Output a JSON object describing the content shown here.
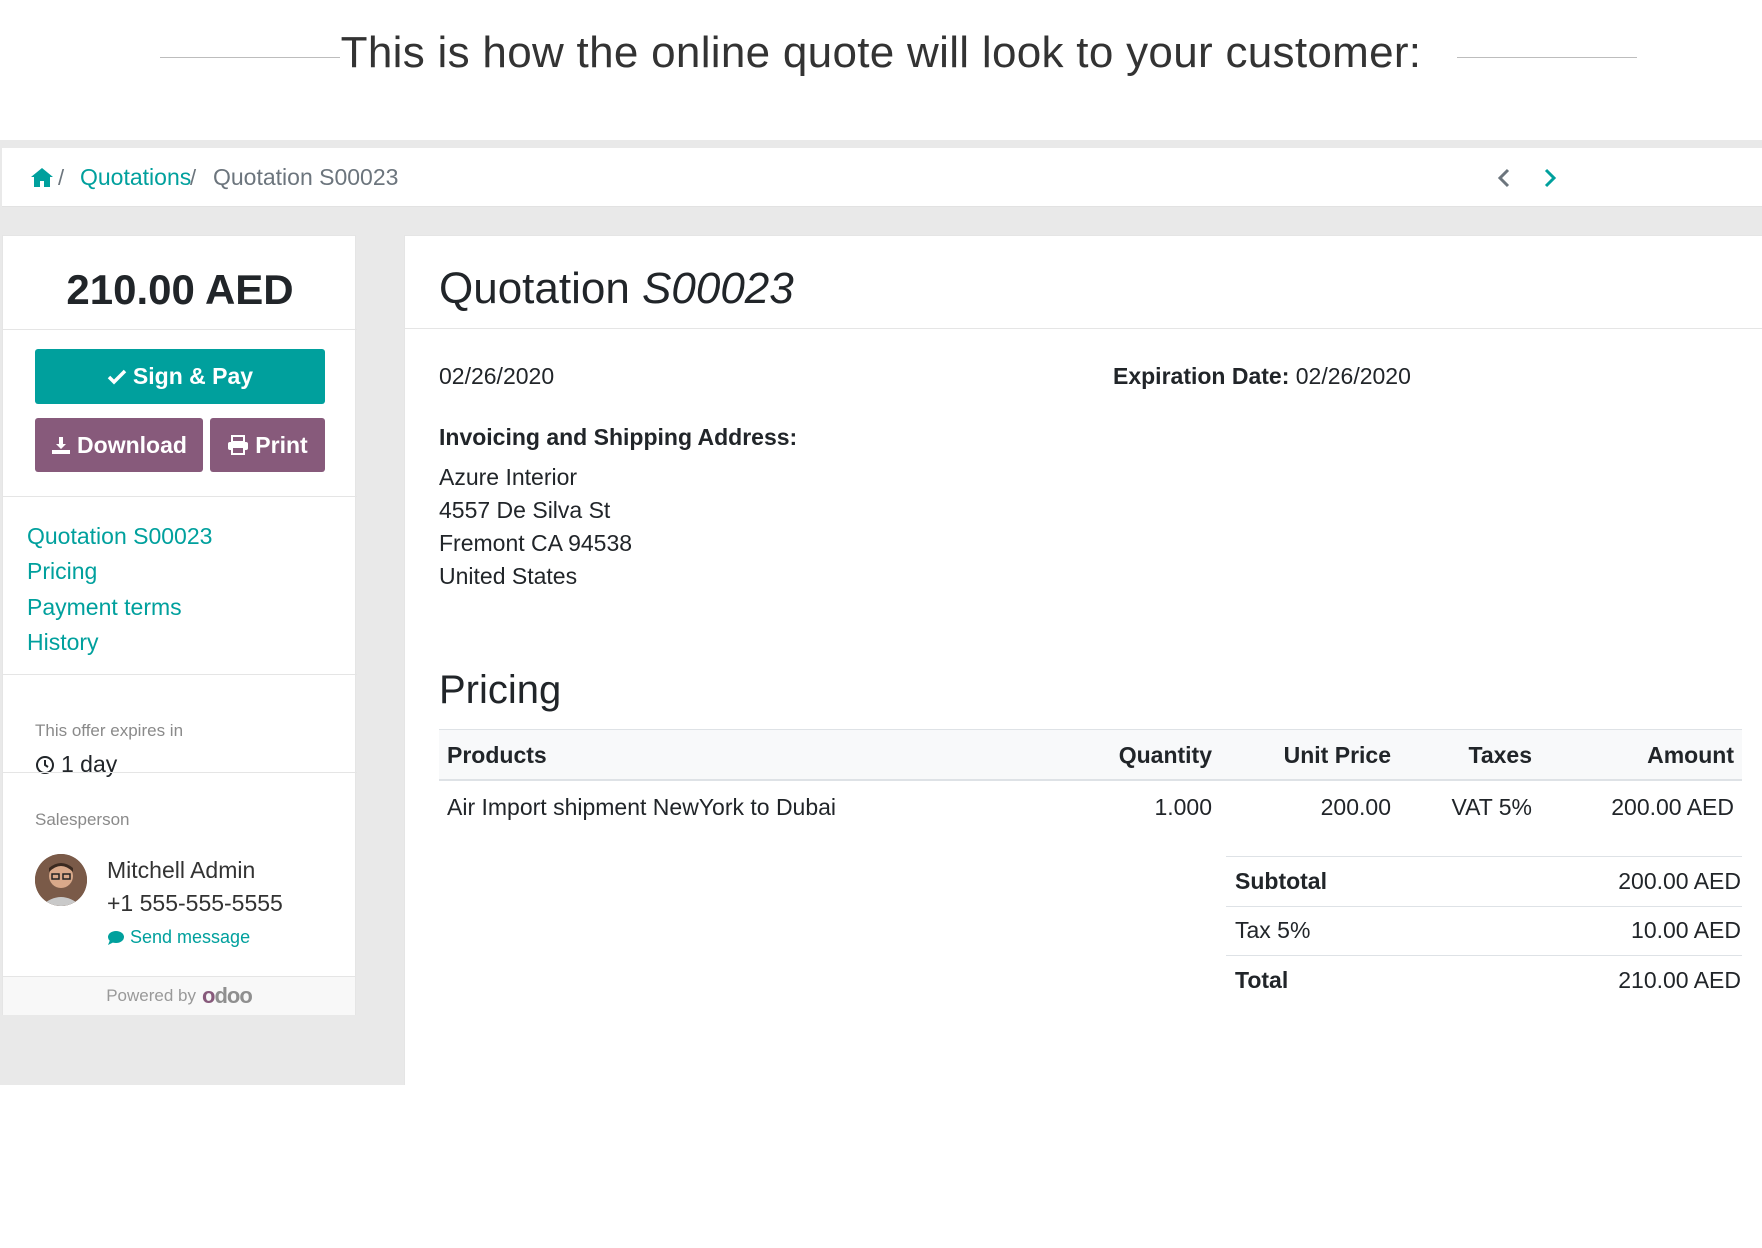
{
  "banner": {
    "text": "This is how the online quote will look to your customer:"
  },
  "breadcrumb": {
    "home_icon": "home-icon",
    "separator": "/",
    "quotations_label": "Quotations",
    "current_label": "Quotation S00023"
  },
  "sidebar": {
    "amount": "210.00 AED",
    "sign_pay_label": "Sign & Pay",
    "download_label": "Download",
    "print_label": "Print",
    "toc": [
      "Quotation S00023",
      "Pricing",
      "Payment terms",
      "History"
    ],
    "expires_label": "This offer expires in",
    "expires_value": "1 day",
    "salesperson_label": "Salesperson",
    "salesperson_name": "Mitchell Admin",
    "salesperson_phone": "+1 555-555-5555",
    "send_message_label": "Send message",
    "powered_by_label": "Powered by",
    "powered_by_brand": "odoo"
  },
  "quote": {
    "title_prefix": "Quotation",
    "title_number": "S00023",
    "date": "02/26/2020",
    "expiration_label": "Expiration Date:",
    "expiration_value": "02/26/2020",
    "address_label": "Invoicing and Shipping Address:",
    "address_lines": [
      "Azure Interior",
      "4557 De Silva St",
      "Fremont CA 94538",
      "United States"
    ]
  },
  "pricing": {
    "heading": "Pricing",
    "columns": [
      "Products",
      "Quantity",
      "Unit Price",
      "Taxes",
      "Amount"
    ],
    "rows": [
      {
        "product": "Air Import shipment NewYork to Dubai",
        "quantity": "1.000",
        "unit_price": "200.00",
        "taxes": "VAT 5%",
        "amount": "200.00 AED"
      }
    ],
    "subtotal_label": "Subtotal",
    "subtotal_value": "200.00 AED",
    "tax_label": "Tax 5%",
    "tax_value": "10.00 AED",
    "total_label": "Total",
    "total_value": "210.00 AED"
  },
  "colors": {
    "primary": "#00a09d",
    "secondary": "#875a7b",
    "background": "#e9e9e9"
  }
}
